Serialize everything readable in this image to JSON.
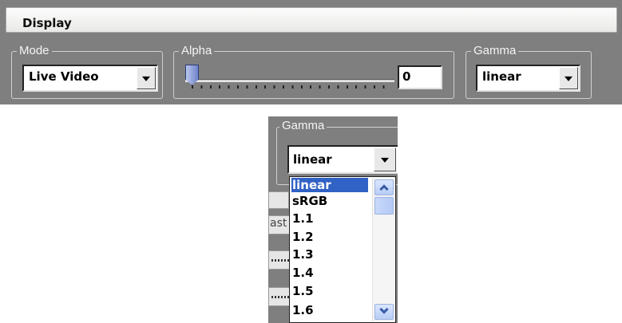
{
  "panel": {
    "title": "Display",
    "mode": {
      "label": "Mode",
      "value": "Live Video"
    },
    "alpha": {
      "label": "Alpha",
      "value": "0",
      "slider_value": 0
    },
    "gamma": {
      "label": "Gamma",
      "value": "linear"
    }
  },
  "dropdown_view": {
    "group_label": "Gamma",
    "selected_value": "linear",
    "partial_strip_text": "ast",
    "options": [
      "linear",
      "sRGB",
      "1.1",
      "1.2",
      "1.3",
      "1.4",
      "1.5",
      "1.6"
    ],
    "highlighted_index": 0
  }
}
